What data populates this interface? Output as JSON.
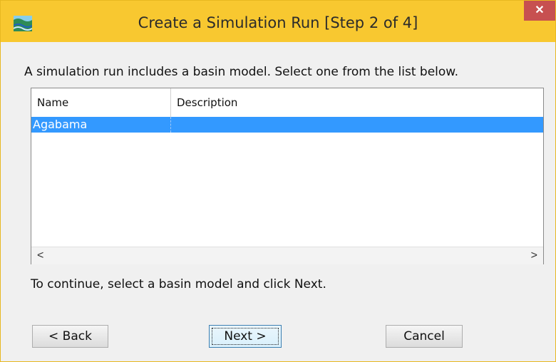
{
  "window": {
    "title": "Create a Simulation Run [Step 2 of 4]",
    "close_label": "✕",
    "app_icon": "hec-hms-icon"
  },
  "instruction": "A simulation run includes a basin model. Select one from the list below.",
  "table": {
    "columns": [
      "Name",
      "Description"
    ],
    "rows": [
      {
        "name": "Agabama",
        "description": "",
        "selected": true
      }
    ],
    "scroll_left": "<",
    "scroll_right": ">"
  },
  "hint": "To continue, select a basin model and click Next.",
  "buttons": {
    "back": "< Back",
    "next": "Next >",
    "cancel": "Cancel"
  },
  "colors": {
    "titlebar": "#f8c830",
    "selection": "#3399ff",
    "close": "#c75050"
  }
}
